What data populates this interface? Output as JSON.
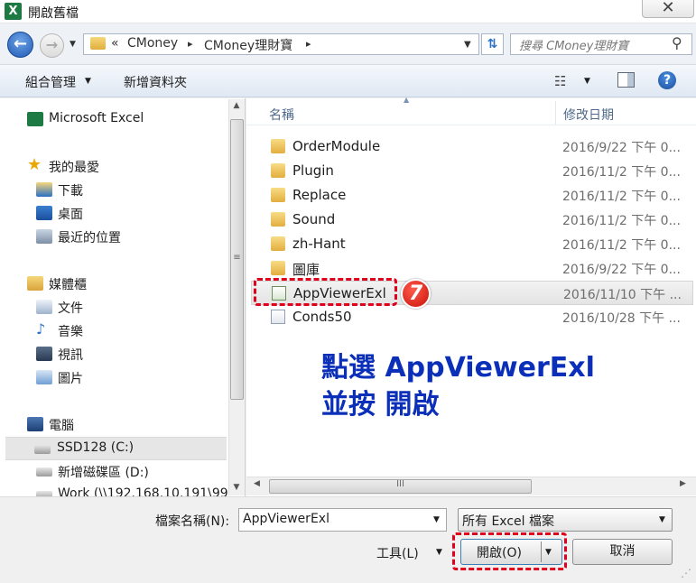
{
  "window": {
    "title": "開啟舊檔",
    "icon_letter": "X",
    "close_glyph": "✕"
  },
  "nav": {
    "back_glyph": "←",
    "forward_glyph": "→",
    "breadcrumb_prefix": "«",
    "crumbs": [
      "CMoney",
      "CMoney理財寶"
    ],
    "crumb_sep": "▸",
    "refresh_glyph": "⇅",
    "search_placeholder": "搜尋 CMoney理財寶",
    "search_glyph": "⚲"
  },
  "toolbar": {
    "organize": "組合管理",
    "new_folder": "新增資料夾",
    "view_glyph": "☷",
    "help_glyph": "?"
  },
  "sidebar": {
    "items": [
      {
        "label": "Microsoft Excel",
        "icon": "excel-icon"
      },
      {
        "label": "我的最愛",
        "icon": "star-icon"
      },
      {
        "label": "下載",
        "icon": "download-icon"
      },
      {
        "label": "桌面",
        "icon": "desktop-icon"
      },
      {
        "label": "最近的位置",
        "icon": "recent-icon"
      },
      {
        "label": "媒體櫃",
        "icon": "library-icon"
      },
      {
        "label": "文件",
        "icon": "documents-icon"
      },
      {
        "label": "音樂",
        "icon": "music-icon"
      },
      {
        "label": "視訊",
        "icon": "video-icon"
      },
      {
        "label": "圖片",
        "icon": "pictures-icon"
      },
      {
        "label": "電腦",
        "icon": "computer-icon"
      },
      {
        "label": "SSD128 (C:)",
        "icon": "drive-icon"
      },
      {
        "label": "新增磁碟區 (D:)",
        "icon": "drive-icon"
      },
      {
        "label": "Work (\\\\192.168.10.191\\99",
        "icon": "network-drive-icon"
      }
    ]
  },
  "file_list": {
    "columns": {
      "name": "名稱",
      "date": "修改日期"
    },
    "rows": [
      {
        "name": "OrderModule",
        "date": "2016/9/22 下午 0...",
        "type": "folder"
      },
      {
        "name": "Plugin",
        "date": "2016/11/2 下午 0...",
        "type": "folder"
      },
      {
        "name": "Replace",
        "date": "2016/11/2 下午 0...",
        "type": "folder"
      },
      {
        "name": "Sound",
        "date": "2016/11/2 下午 0...",
        "type": "folder"
      },
      {
        "name": "zh-Hant",
        "date": "2016/11/2 下午 0...",
        "type": "folder"
      },
      {
        "name": "圖庫",
        "date": "2016/9/22 下午 0...",
        "type": "folder"
      },
      {
        "name": "AppViewerExl",
        "date": "2016/11/10 下午 ...",
        "type": "excel-file"
      },
      {
        "name": "Conds50",
        "date": "2016/10/28 下午 ...",
        "type": "file"
      }
    ],
    "scroll_grip": "III"
  },
  "annotation": {
    "step_badge": "7",
    "line1": "點選 AppViewerExl",
    "line2": "並按  開啟"
  },
  "bottom": {
    "filename_label": "檔案名稱(N):",
    "filename_value": "AppViewerExl",
    "filter_value": "所有 Excel 檔案",
    "tools_label": "工具(L)",
    "open_label": "開啟(O)",
    "cancel_label": "取消"
  },
  "colors": {
    "annotation_red": "#e0001b",
    "instruction_blue": "#0b2fb8",
    "accent_blue": "#1f5bb6"
  }
}
